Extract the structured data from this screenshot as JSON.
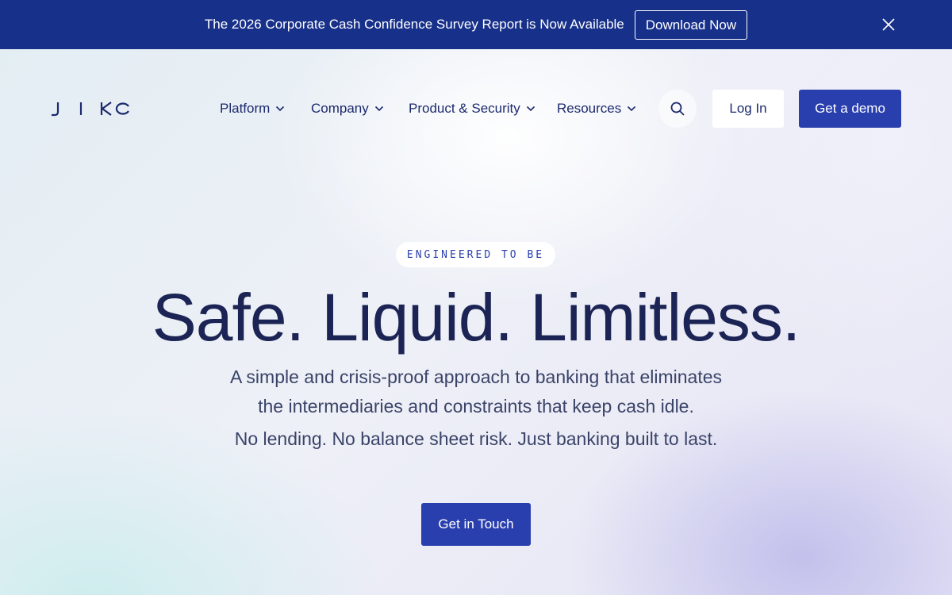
{
  "announcement": {
    "text": "The 2026 Corporate Cash Confidence Survey Report is Now Available",
    "button_label": "Download Now",
    "close_icon": "close-icon"
  },
  "brand": {
    "logo_text": "JIKO",
    "primary_color": "#2a3fae",
    "banner_color": "#17308a",
    "text_color": "#1b2454"
  },
  "nav": {
    "items": [
      {
        "label": "Platform"
      },
      {
        "label": "Company"
      },
      {
        "label": "Product & Security"
      },
      {
        "label": "Resources"
      }
    ],
    "search_icon": "search-icon",
    "login_label": "Log In",
    "demo_label": "Get a demo"
  },
  "hero": {
    "eyebrow": "ENGINEERED TO BE",
    "headline": "Safe. Liquid. Limitless.",
    "subtitle_line1": "A simple and crisis-proof approach to banking that eliminates",
    "subtitle_line2": "the intermediaries and constraints that keep cash idle.",
    "subtitle_line3": "No lending. No balance sheet risk. Just banking built to last.",
    "cta_label": "Get in Touch"
  }
}
